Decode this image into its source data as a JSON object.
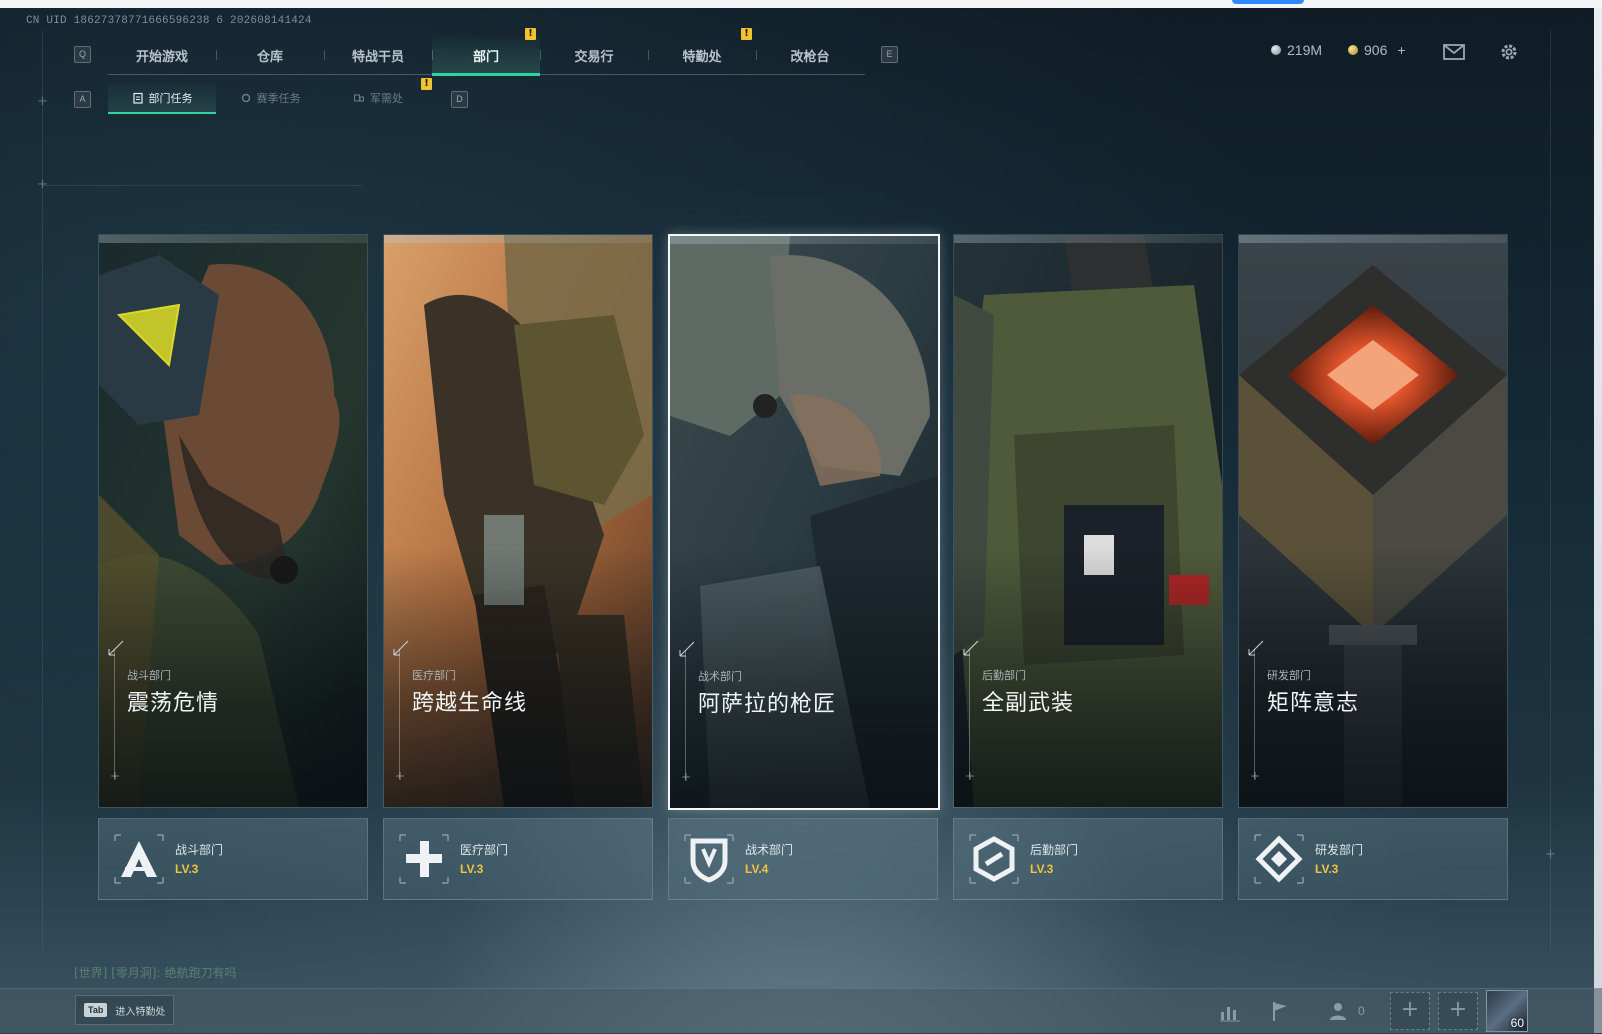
{
  "uid": "CN UID 18627378771666596238 6 202608141424",
  "main_tabs": [
    {
      "label": "开始游戏"
    },
    {
      "label": "仓库"
    },
    {
      "label": "特战干员"
    },
    {
      "label": "部门"
    },
    {
      "label": "交易行"
    },
    {
      "label": "特勤处"
    },
    {
      "label": "改枪台"
    }
  ],
  "keycaps": {
    "prev_tab": "Q",
    "next_tab": "E",
    "prev_sub": "A",
    "next_sub": "D"
  },
  "sub_tabs": [
    {
      "label": "部门任务"
    },
    {
      "label": "赛季任务"
    },
    {
      "label": "军需处"
    }
  ],
  "currency": {
    "silver": "219M",
    "gold": "906",
    "add": "+"
  },
  "cards": [
    {
      "category": "战斗部门",
      "title": "震荡危情"
    },
    {
      "category": "医疗部门",
      "title": "跨越生命线"
    },
    {
      "category": "战术部门",
      "title": "阿萨拉的枪匠"
    },
    {
      "category": "后勤部门",
      "title": "全副武装"
    },
    {
      "category": "研发部门",
      "title": "矩阵意志"
    }
  ],
  "departments": [
    {
      "name": "战斗部门",
      "level": "LV.3",
      "icon": "combat-dept-icon"
    },
    {
      "name": "医疗部门",
      "level": "LV.3",
      "icon": "medical-dept-icon"
    },
    {
      "name": "战术部门",
      "level": "LV.4",
      "icon": "tactical-dept-icon"
    },
    {
      "name": "后勤部门",
      "level": "LV.3",
      "icon": "logistics-dept-icon"
    },
    {
      "name": "研发部门",
      "level": "LV.3",
      "icon": "research-dept-icon"
    }
  ],
  "chat": {
    "channel": "[世界]",
    "user": "[零月洞]",
    "message": "绝航跑刀有吗"
  },
  "bottom": {
    "tab_key": "Tab",
    "tab_hint": "进入特勤处",
    "party_count": "0",
    "avatar_level": "60"
  },
  "colors": {
    "accent": "#2fd5a0",
    "alert": "#f2c230",
    "level": "#f1c43a"
  }
}
